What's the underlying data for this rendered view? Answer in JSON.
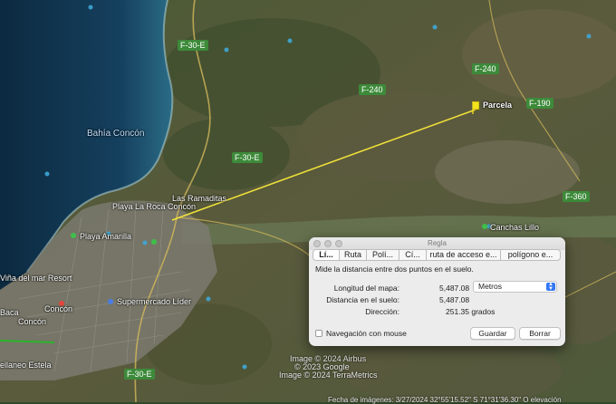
{
  "map": {
    "place_labels": {
      "bahia": "Bahía Concón",
      "ramaditas": "Las Ramaditas",
      "playa_roca": "Playa La Roca Concón",
      "playa_amarilla": "Playa Amarilla",
      "vina": "Viña del mar Resort",
      "concon1": "Concón",
      "concon2": "Concón",
      "lider": "Supermercado Líder",
      "canchas": "Canchas Lillo",
      "parcela": "Parcela",
      "baca": "Baca",
      "estela": "ellaneo Estela"
    },
    "roads": {
      "f30e_1": "F-30-E",
      "f30e_2": "F-30-E",
      "f30e_3": "F-30-E",
      "f240_1": "F-240",
      "f240_2": "F-240",
      "f190": "F-190",
      "f360": "F-360"
    },
    "credits": {
      "line1": "Image © 2024 Airbus",
      "line2": "© 2023 Google",
      "line3": "Image © 2024 TerraMetrics",
      "bottom": "Fecha de imágenes: 3/27/2024    32°55'15.52\" S    71°31'36.30\" O  elevación"
    },
    "colors": {
      "ruler_line": "#f2e33a",
      "road_shield": "#3d8a3a"
    }
  },
  "dialog": {
    "title": "Regla",
    "tabs": [
      "Lí...",
      "Ruta",
      "Polí...",
      "Cí...",
      "ruta de acceso e...",
      "polígono e..."
    ],
    "active_tab": 0,
    "description": "Mide la distancia entre dos puntos en el suelo.",
    "map_length_label": "Longitud del mapa:",
    "map_length_value": "5,487.08",
    "ground_length_label": "Distancia en el suelo:",
    "ground_length_value": "5,487.08",
    "heading_label": "Dirección:",
    "heading_value": "251.35 grados",
    "units_selected": "Metros",
    "mouse_nav_label": "Navegación con mouse",
    "mouse_nav_checked": false,
    "save_label": "Guardar",
    "clear_label": "Borrar"
  }
}
